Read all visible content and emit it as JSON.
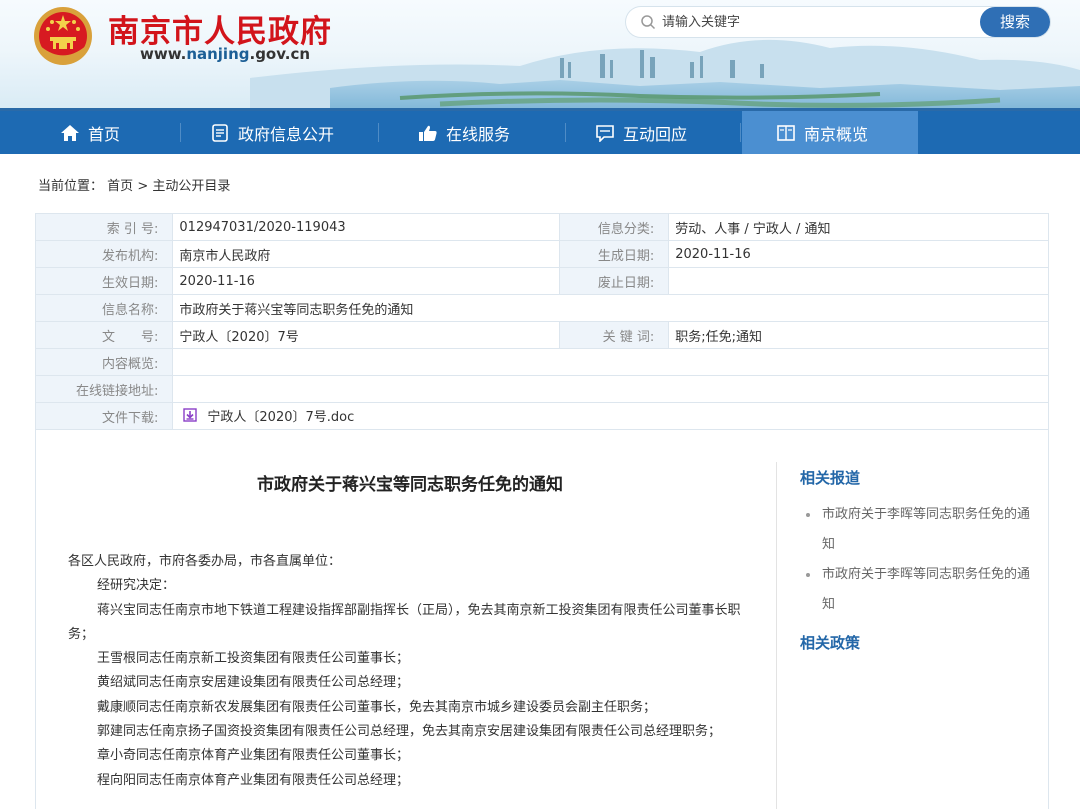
{
  "header": {
    "site_title": "南京市人民政府",
    "url_prefix": "www.",
    "url_highlight": "nanjing",
    "url_suffix": ".gov.cn",
    "search_placeholder": "请输入关键字",
    "search_button": "搜索"
  },
  "nav": {
    "items": [
      {
        "label": "首页",
        "icon": "home-icon"
      },
      {
        "label": "政府信息公开",
        "icon": "document-icon"
      },
      {
        "label": "在线服务",
        "icon": "thumbs-up-icon"
      },
      {
        "label": "互动回应",
        "icon": "chat-icon"
      },
      {
        "label": "南京概览",
        "icon": "book-icon"
      }
    ],
    "active_index": 4
  },
  "breadcrumb": {
    "prefix": "当前位置：",
    "home": "首页",
    "separator": ">",
    "current": "主动公开目录"
  },
  "info": {
    "index_label": "索 引 号:",
    "index_value": "012947031/2020-119043",
    "category_label": "信息分类:",
    "category_value": "劳动、人事 / 宁政人 / 通知",
    "publisher_label": "发布机构:",
    "publisher_value": "南京市人民政府",
    "created_label": "生成日期:",
    "created_value": "2020-11-16",
    "effective_label": "生效日期:",
    "effective_value": "2020-11-16",
    "expire_label": "废止日期:",
    "expire_value": "",
    "name_label": "信息名称:",
    "name_value": "市政府关于蒋兴宝等同志职务任免的通知",
    "docno_label": "文　　号:",
    "docno_value": "宁政人〔2020〕7号",
    "keywords_label": "关 键 词:",
    "keywords_value": "职务;任免;通知",
    "summary_label": "内容概览:",
    "summary_value": "",
    "link_label": "在线链接地址:",
    "link_value": "",
    "download_label": "文件下载:",
    "download_value": "宁政人〔2020〕7号.doc"
  },
  "document": {
    "title": "市政府关于蒋兴宝等同志职务任免的通知",
    "salutation": "各区人民政府，市府各委办局，市各直属单位：",
    "paragraphs": [
      "经研究决定：",
      "蒋兴宝同志任南京市地下铁道工程建设指挥部副指挥长（正局），免去其南京新工投资集团有限责任公司董事长职务；",
      "王雪根同志任南京新工投资集团有限责任公司董事长；",
      "黄绍斌同志任南京安居建设集团有限责任公司总经理；",
      "戴康顺同志任南京新农发展集团有限责任公司董事长，免去其南京市城乡建设委员会副主任职务；",
      "郭建同志任南京扬子国资投资集团有限责任公司总经理，免去其南京安居建设集团有限责任公司总经理职务；",
      "章小奇同志任南京体育产业集团有限责任公司董事长；",
      "程向阳同志任南京体育产业集团有限责任公司总经理；"
    ]
  },
  "sidebar": {
    "related_reports_title": "相关报道",
    "related_reports": [
      "市政府关于李晖等同志职务任免的通知",
      "市政府关于李晖等同志职务任免的通知"
    ],
    "related_policies_title": "相关政策"
  },
  "colors": {
    "brand_red": "#d2141b",
    "nav_blue": "#1d6ab3",
    "nav_active": "#4b8fd1",
    "link_blue": "#2367a8",
    "label_bg": "#eef4fa"
  }
}
